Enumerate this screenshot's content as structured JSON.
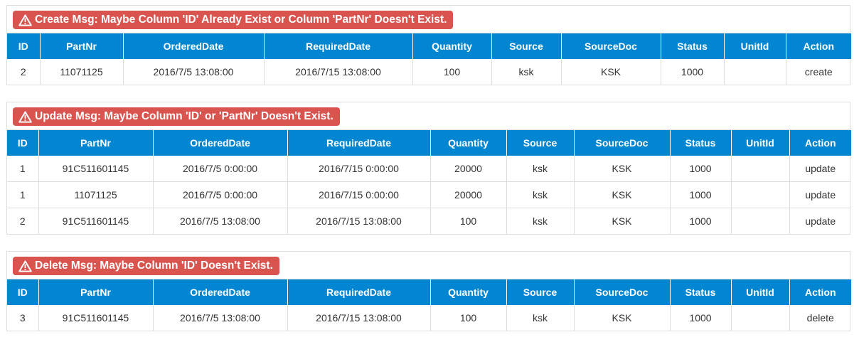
{
  "columns": [
    "ID",
    "PartNr",
    "OrderedDate",
    "RequiredDate",
    "Quantity",
    "Source",
    "SourceDoc",
    "Status",
    "UnitId",
    "Action"
  ],
  "create": {
    "message": "Create Msg: Maybe Column 'ID' Already Exist or Column 'PartNr' Doesn't Exist.",
    "rows": [
      [
        "2",
        "11071125",
        "2016/7/5 13:08:00",
        "2016/7/15 13:08:00",
        "100",
        "ksk",
        "KSK",
        "1000",
        "",
        "create"
      ]
    ]
  },
  "update": {
    "message": "Update Msg: Maybe Column 'ID' or 'PartNr' Doesn't Exist.",
    "rows": [
      [
        "1",
        "91C511601145",
        "2016/7/5 0:00:00",
        "2016/7/15 0:00:00",
        "20000",
        "ksk",
        "KSK",
        "1000",
        "",
        "update"
      ],
      [
        "1",
        "11071125",
        "2016/7/5 0:00:00",
        "2016/7/15 0:00:00",
        "20000",
        "ksk",
        "KSK",
        "1000",
        "",
        "update"
      ],
      [
        "2",
        "91C511601145",
        "2016/7/5 13:08:00",
        "2016/7/15 13:08:00",
        "100",
        "ksk",
        "KSK",
        "1000",
        "",
        "update"
      ]
    ]
  },
  "delete": {
    "message": "Delete Msg: Maybe Column 'ID' Doesn't Exist.",
    "rows": [
      [
        "3",
        "91C511601145",
        "2016/7/5 13:08:00",
        "2016/7/15 13:08:00",
        "100",
        "ksk",
        "KSK",
        "1000",
        "",
        "delete"
      ]
    ]
  },
  "colors": {
    "header_bg": "#0286d1",
    "alert_bg": "#d9534f",
    "border": "#dddddd"
  },
  "icons": {
    "alert": "warning-triangle-icon"
  }
}
